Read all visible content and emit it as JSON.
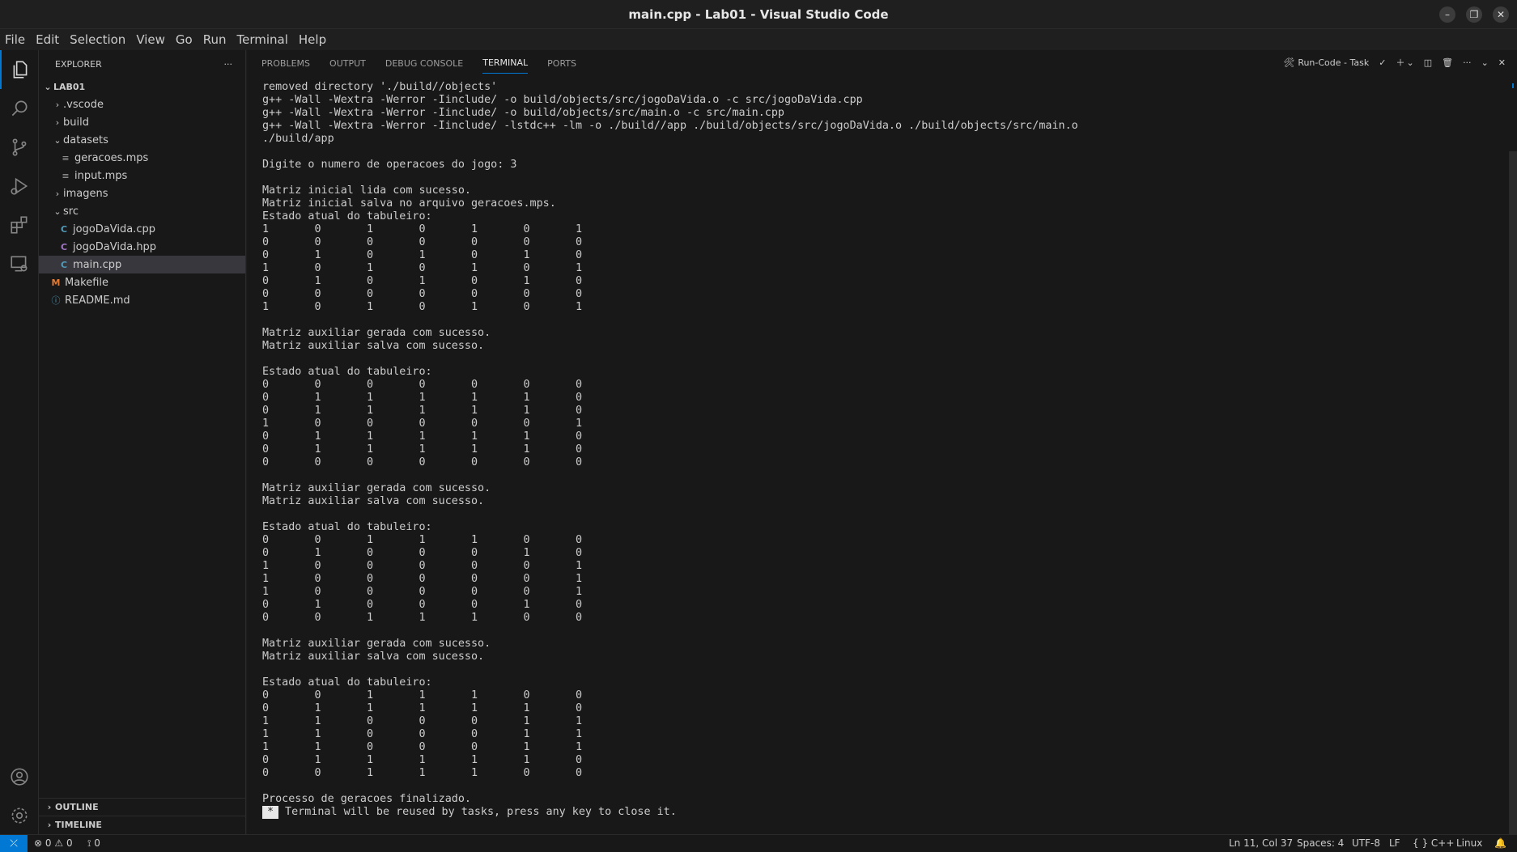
{
  "window": {
    "title": "main.cpp - Lab01 - Visual Studio Code"
  },
  "menu": [
    "File",
    "Edit",
    "Selection",
    "View",
    "Go",
    "Run",
    "Terminal",
    "Help"
  ],
  "explorer": {
    "header": "EXPLORER",
    "more": "···",
    "root": "LAB01",
    "items": [
      {
        "label": ".vscode",
        "type": "folder",
        "expanded": false
      },
      {
        "label": "build",
        "type": "folder",
        "expanded": false
      },
      {
        "label": "datasets",
        "type": "folder",
        "expanded": true
      },
      {
        "label": "geracoes.mps",
        "type": "file"
      },
      {
        "label": "input.mps",
        "type": "file"
      },
      {
        "label": "imagens",
        "type": "folder",
        "expanded": false
      },
      {
        "label": "src",
        "type": "folder",
        "expanded": true
      },
      {
        "label": "jogoDaVida.cpp",
        "type": "file"
      },
      {
        "label": "jogoDaVida.hpp",
        "type": "file"
      },
      {
        "label": "main.cpp",
        "type": "file",
        "selected": true
      },
      {
        "label": "Makefile",
        "type": "file"
      },
      {
        "label": "README.md",
        "type": "file"
      }
    ],
    "outline": "OUTLINE",
    "timeline": "TIMELINE"
  },
  "panel": {
    "tabs": [
      "PROBLEMS",
      "OUTPUT",
      "DEBUG CONSOLE",
      "TERMINAL",
      "PORTS"
    ],
    "active_tab": "TERMINAL",
    "task_label": "Run-Code - Task"
  },
  "terminal": {
    "lines": [
      "removed directory './build//objects'",
      "g++ -Wall -Wextra -Werror -Iinclude/ -o build/objects/src/jogoDaVida.o -c src/jogoDaVida.cpp",
      "g++ -Wall -Wextra -Werror -Iinclude/ -o build/objects/src/main.o -c src/main.cpp",
      "g++ -Wall -Wextra -Werror -Iinclude/ -lstdc++ -lm -o ./build//app ./build/objects/src/jogoDaVida.o ./build/objects/src/main.o",
      "./build/app",
      "",
      "Digite o numero de operacoes do jogo: 3",
      "",
      "Matriz inicial lida com sucesso.",
      "Matriz inicial salva no arquivo geracoes.mps.",
      "Estado atual do tabuleiro:",
      "1       0       1       0       1       0       1",
      "0       0       0       0       0       0       0",
      "0       1       0       1       0       1       0",
      "1       0       1       0       1       0       1",
      "0       1       0       1       0       1       0",
      "0       0       0       0       0       0       0",
      "1       0       1       0       1       0       1",
      "",
      "Matriz auxiliar gerada com sucesso.",
      "Matriz auxiliar salva com sucesso.",
      "",
      "Estado atual do tabuleiro:",
      "0       0       0       0       0       0       0",
      "0       1       1       1       1       1       0",
      "0       1       1       1       1       1       0",
      "1       0       0       0       0       0       1",
      "0       1       1       1       1       1       0",
      "0       1       1       1       1       1       0",
      "0       0       0       0       0       0       0",
      "",
      "Matriz auxiliar gerada com sucesso.",
      "Matriz auxiliar salva com sucesso.",
      "",
      "Estado atual do tabuleiro:",
      "0       0       1       1       1       0       0",
      "0       1       0       0       0       1       0",
      "1       0       0       0       0       0       1",
      "1       0       0       0       0       0       1",
      "1       0       0       0       0       0       1",
      "0       1       0       0       0       1       0",
      "0       0       1       1       1       0       0",
      "",
      "Matriz auxiliar gerada com sucesso.",
      "Matriz auxiliar salva com sucesso.",
      "",
      "Estado atual do tabuleiro:",
      "0       0       1       1       1       0       0",
      "0       1       1       1       1       1       0",
      "1       1       0       0       0       1       1",
      "1       1       0       0       0       1       1",
      "1       1       0       0       0       1       1",
      "0       1       1       1       1       1       0",
      "0       0       1       1       1       0       0",
      "",
      "Processo de geracoes finalizado."
    ],
    "cursor_mark": "*",
    "final_line": " Terminal will be reused by tasks, press any key to close it."
  },
  "status": {
    "errors": "0",
    "warnings": "0",
    "ports": "0",
    "position": "Ln 11, Col 37",
    "spaces": "Spaces: 4",
    "encoding": "UTF-8",
    "eol": "LF",
    "language": "C++",
    "platform": "Linux"
  },
  "colors": {
    "accent": "#0078d4",
    "background": "#1e1e1e",
    "sidebar": "#181818"
  }
}
